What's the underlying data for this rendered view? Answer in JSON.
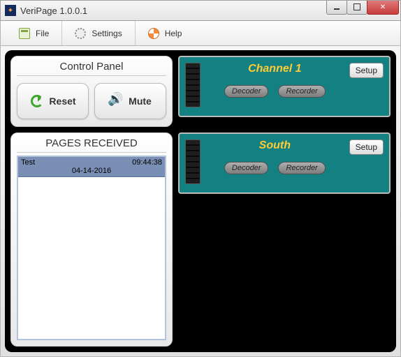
{
  "window": {
    "title": "VeriPage 1.0.0.1"
  },
  "toolbar": {
    "file": "File",
    "settings": "Settings",
    "help": "Help"
  },
  "control_panel": {
    "title": "Control Panel",
    "reset": "Reset",
    "mute": "Mute"
  },
  "pages": {
    "title": "PAGES RECEIVED",
    "items": [
      {
        "name": "Test",
        "time": "09:44:38",
        "date": "04-14-2016"
      }
    ]
  },
  "channels": [
    {
      "title": "Channel 1",
      "decoder": "Decoder",
      "recorder": "Recorder",
      "setup": "Setup"
    },
    {
      "title": "South",
      "decoder": "Decoder",
      "recorder": "Recorder",
      "setup": "Setup"
    }
  ]
}
